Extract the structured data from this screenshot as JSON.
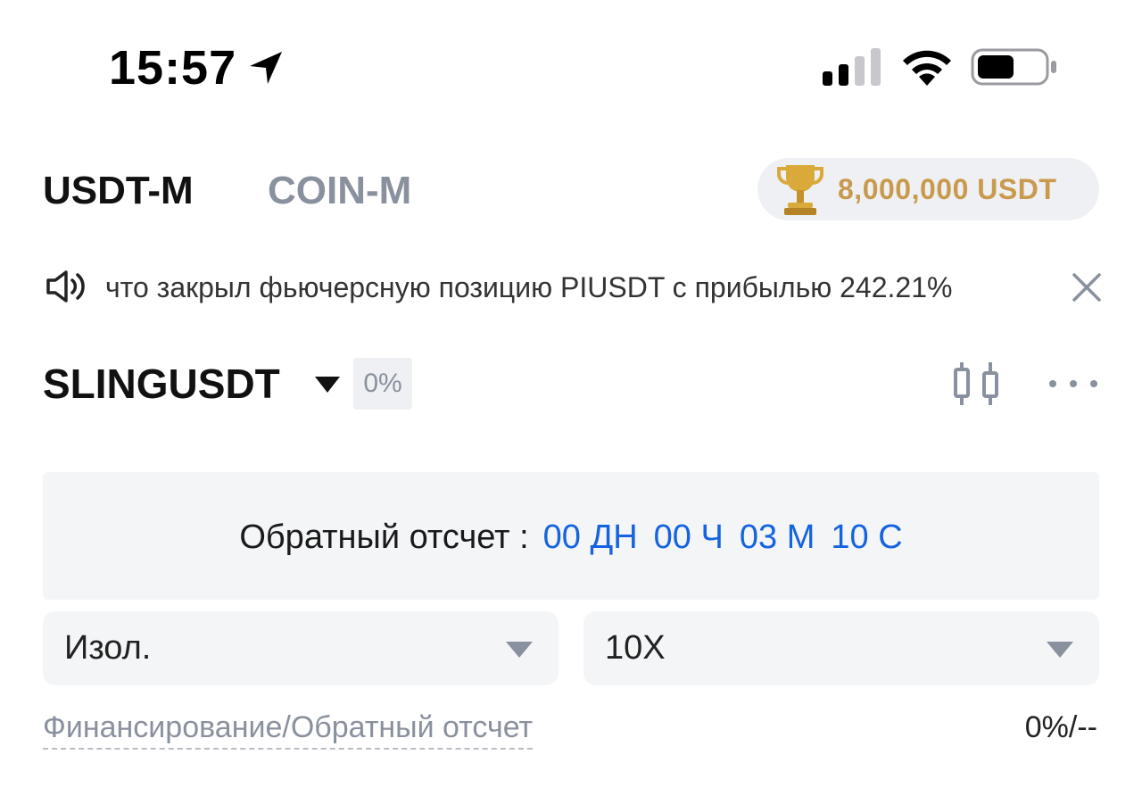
{
  "status_bar": {
    "time": "15:57",
    "icons": [
      "location-arrow-icon",
      "cellular-signal-icon",
      "wifi-icon",
      "battery-icon"
    ]
  },
  "tabs": [
    {
      "label": "USDT-M",
      "active": true
    },
    {
      "label": "COIN-M",
      "active": false
    }
  ],
  "prize": {
    "icon": "trophy-icon",
    "label": "8,000,000 USDT"
  },
  "ticker": {
    "icon": "speaker-icon",
    "text": "что закрыл фьючерсную позицию PIUSDT с прибылью 242.21%",
    "close_icon": "close-icon"
  },
  "symbol": {
    "name": "SLINGUSDT",
    "change": "0%"
  },
  "countdown": {
    "label": "Обратный отсчет :",
    "days": "00",
    "days_unit": "ДН",
    "hours": "00",
    "hours_unit": "Ч",
    "minutes": "03",
    "minutes_unit": "М",
    "seconds": "10",
    "seconds_unit": "С"
  },
  "margin_mode": {
    "value": "Изол."
  },
  "leverage": {
    "value": "10X"
  },
  "funding": {
    "label": "Финансирование/Обратный отсчет",
    "value": "0%/--"
  },
  "colors": {
    "accent_blue": "#1663e0",
    "gold": "#c99a4d",
    "muted": "#8a919e",
    "panel": "#f4f5f7"
  }
}
